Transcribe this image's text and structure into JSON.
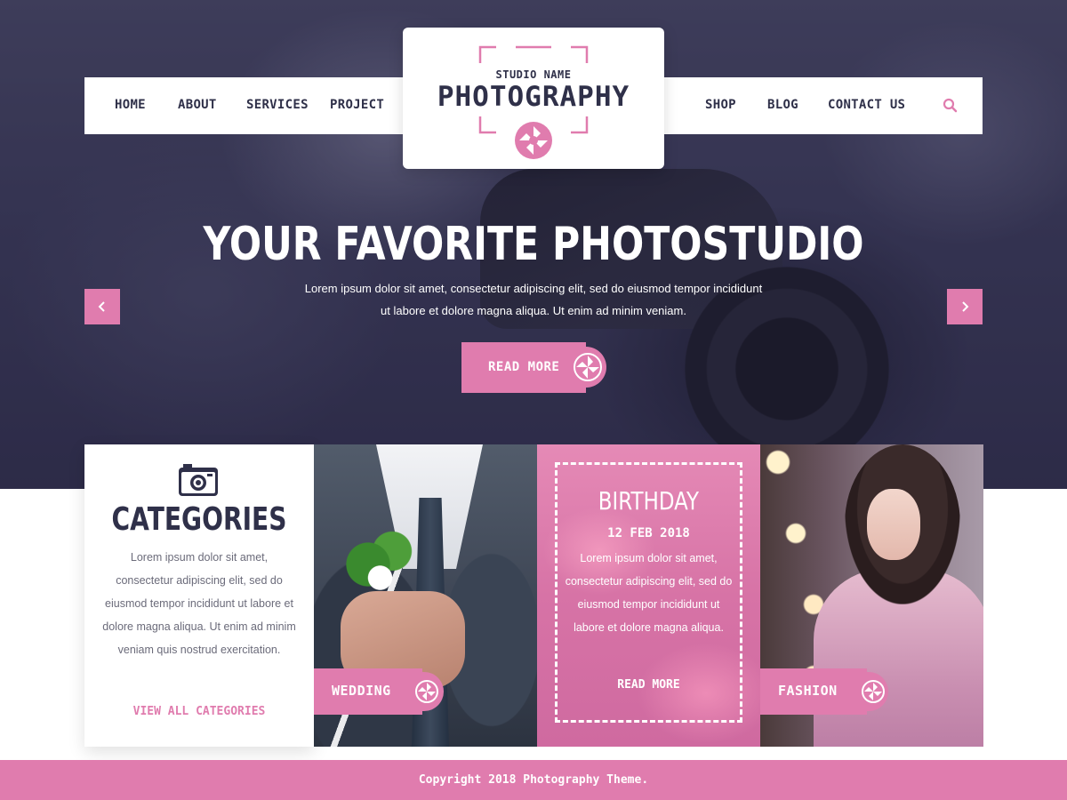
{
  "nav": {
    "left_items": [
      {
        "label": "HOME"
      },
      {
        "label": "ABOUT"
      },
      {
        "label": "SERVICES"
      },
      {
        "label": "PROJECT"
      }
    ],
    "right_items": [
      {
        "label": "SHOP"
      },
      {
        "label": "BLOG"
      },
      {
        "label": "CONTACT US"
      }
    ],
    "search_icon": "search-icon"
  },
  "logo": {
    "small": "STUDIO NAME",
    "big": "PHOTOGRAPHY"
  },
  "hero": {
    "title": "YOUR FAVORITE PHOTOSTUDIO",
    "text_line1": "Lorem ipsum dolor sit amet, consectetur adipiscing elit, sed do eiusmod tempor incididunt",
    "text_line2": "ut labore et dolore magna aliqua. Ut enim ad minim veniam.",
    "button": "READ MORE",
    "prev_icon": "chevron-left-icon",
    "next_icon": "chevron-right-icon"
  },
  "categories": {
    "title": "CATEGORIES",
    "text": "Lorem ipsum dolor sit amet, consectetur adipiscing elit, sed do eiusmod tempor incididunt ut labore et dolore magna aliqua. Ut enim ad minim veniam quis nostrud exercitation.",
    "link": "VIEW ALL CATEGORIES",
    "icon": "camera-icon"
  },
  "wedding": {
    "label": "WEDDING"
  },
  "birthday": {
    "title": "BIRTHDAY",
    "date": "12 FEB 2018",
    "text": "Lorem ipsum dolor sit amet, consectetur adipiscing elit, sed do eiusmod tempor incididunt ut labore et dolore magna aliqua.",
    "link": "READ MORE"
  },
  "fashion": {
    "label": "FASHION"
  },
  "footer": {
    "text": "Copyright 2018 Photography Theme."
  },
  "colors": {
    "accent": "#e07cae",
    "dark": "#2f3049",
    "hero_overlay": "#3b3b58"
  }
}
